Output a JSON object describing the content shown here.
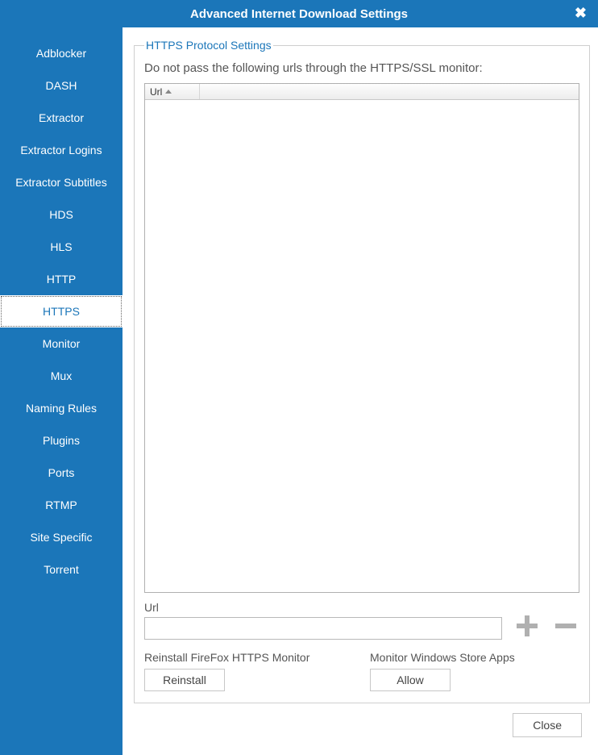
{
  "title": "Advanced Internet Download Settings",
  "sidebar": {
    "items": [
      {
        "label": "Adblocker",
        "selected": false
      },
      {
        "label": "DASH",
        "selected": false
      },
      {
        "label": "Extractor",
        "selected": false
      },
      {
        "label": "Extractor Logins",
        "selected": false
      },
      {
        "label": "Extractor Subtitles",
        "selected": false
      },
      {
        "label": "HDS",
        "selected": false
      },
      {
        "label": "HLS",
        "selected": false
      },
      {
        "label": "HTTP",
        "selected": false
      },
      {
        "label": "HTTPS",
        "selected": true
      },
      {
        "label": "Monitor",
        "selected": false
      },
      {
        "label": "Mux",
        "selected": false
      },
      {
        "label": "Naming Rules",
        "selected": false
      },
      {
        "label": "Plugins",
        "selected": false
      },
      {
        "label": "Ports",
        "selected": false
      },
      {
        "label": "RTMP",
        "selected": false
      },
      {
        "label": "Site Specific",
        "selected": false
      },
      {
        "label": "Torrent",
        "selected": false
      }
    ]
  },
  "group": {
    "legend": "HTTPS Protocol Settings",
    "description": "Do not pass the following urls through the HTTPS/SSL monitor:",
    "table_column": "Url",
    "url_label": "Url",
    "url_value": "",
    "reinstall_label": "Reinstall FireFox HTTPS Monitor",
    "reinstall_button": "Reinstall",
    "allow_label": "Monitor Windows Store Apps",
    "allow_button": "Allow"
  },
  "footer": {
    "close": "Close"
  }
}
